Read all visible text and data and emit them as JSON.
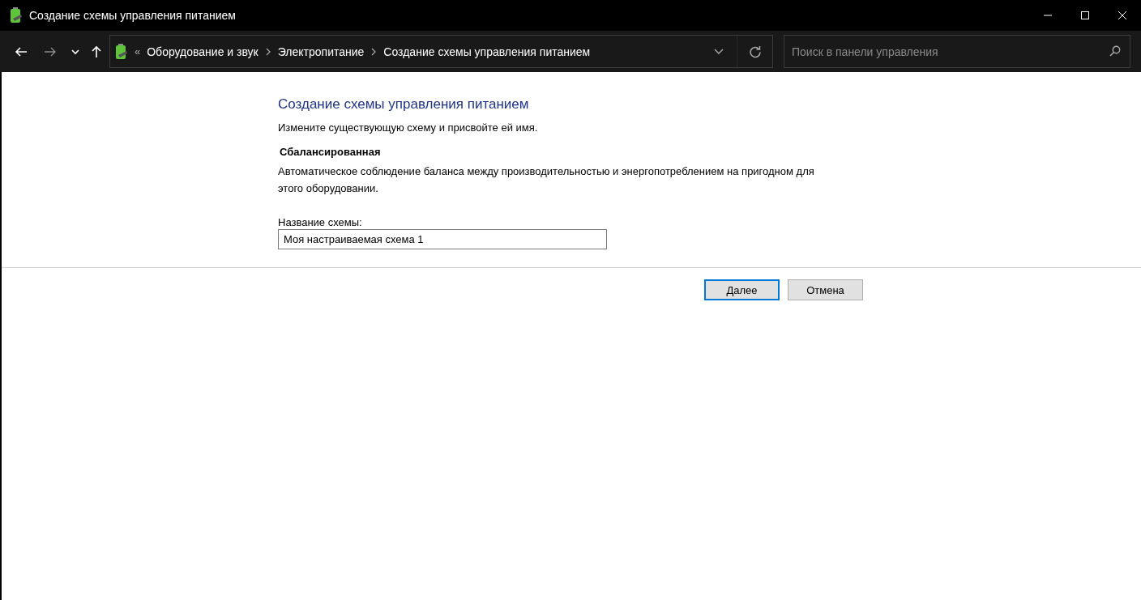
{
  "window": {
    "title": "Создание схемы управления питанием"
  },
  "address_bar": {
    "overflow": "«",
    "crumbs": [
      "Оборудование и звук",
      "Электропитание",
      "Создание схемы управления питанием"
    ]
  },
  "search": {
    "placeholder": "Поиск в панели управления"
  },
  "content": {
    "heading": "Создание схемы управления питанием",
    "intro": "Измените существующую схему и присвойте ей имя.",
    "plan_name": "Сбалансированная",
    "plan_description": "Автоматическое соблюдение баланса между производительностью и энергопотреблением на пригодном для этого оборудовании.",
    "field_label": "Название схемы:",
    "field_value": "Моя настраиваемая схема 1"
  },
  "buttons": [
    {
      "label": "Далее",
      "default": true
    },
    {
      "label": "Отмена",
      "default": false
    }
  ]
}
